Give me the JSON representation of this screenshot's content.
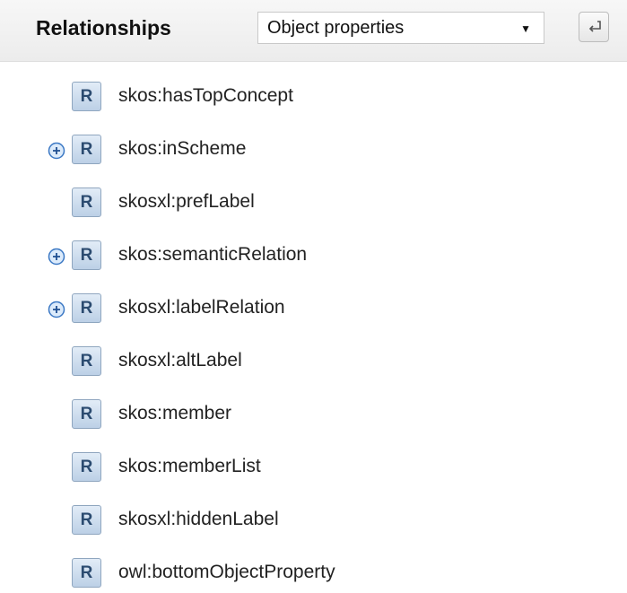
{
  "header": {
    "title": "Relationships",
    "select": {
      "selected": "Object properties",
      "arrow": "▼"
    }
  },
  "tree": {
    "items": [
      {
        "badge": "R",
        "label": "skos:hasTopConcept",
        "expandable": false
      },
      {
        "badge": "R",
        "label": "skos:inScheme",
        "expandable": true
      },
      {
        "badge": "R",
        "label": "skosxl:prefLabel",
        "expandable": false
      },
      {
        "badge": "R",
        "label": "skos:semanticRelation",
        "expandable": true
      },
      {
        "badge": "R",
        "label": "skosxl:labelRelation",
        "expandable": true
      },
      {
        "badge": "R",
        "label": "skosxl:altLabel",
        "expandable": false
      },
      {
        "badge": "R",
        "label": "skos:member",
        "expandable": false
      },
      {
        "badge": "R",
        "label": "skos:memberList",
        "expandable": false
      },
      {
        "badge": "R",
        "label": "skosxl:hiddenLabel",
        "expandable": false
      },
      {
        "badge": "R",
        "label": "owl:bottomObjectProperty",
        "expandable": false
      }
    ]
  }
}
